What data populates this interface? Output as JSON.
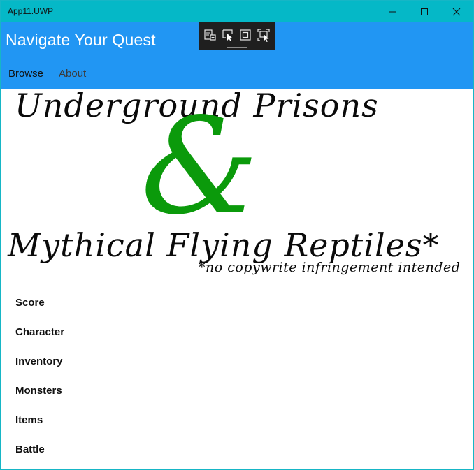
{
  "window": {
    "title": "App11.UWP"
  },
  "header": {
    "title": "Navigate Your Quest",
    "tabs": [
      {
        "label": "Browse",
        "selected": true
      },
      {
        "label": "About",
        "selected": false
      }
    ]
  },
  "banner": {
    "line1": "Underground Prisons",
    "ampersand": "&",
    "line2": "Mythical Flying  Reptiles*",
    "disclaimer": "*no copywrite infringement intended"
  },
  "menu": {
    "items": [
      {
        "label": "Score"
      },
      {
        "label": "Character"
      },
      {
        "label": "Inventory"
      },
      {
        "label": "Monsters"
      },
      {
        "label": "Items"
      },
      {
        "label": "Battle"
      }
    ]
  },
  "colors": {
    "titlebar": "#05b8c7",
    "header": "#2196f3",
    "ampersand": "#0b9a0b",
    "debug_toolbar": "#1f1f1f"
  },
  "icons": {
    "debug_toolbar": [
      "live-visual-tree-icon",
      "select-element-icon",
      "display-layout-adorners-icon",
      "track-focused-element-icon"
    ],
    "window_controls": [
      "minimize-icon",
      "maximize-icon",
      "close-icon"
    ]
  }
}
